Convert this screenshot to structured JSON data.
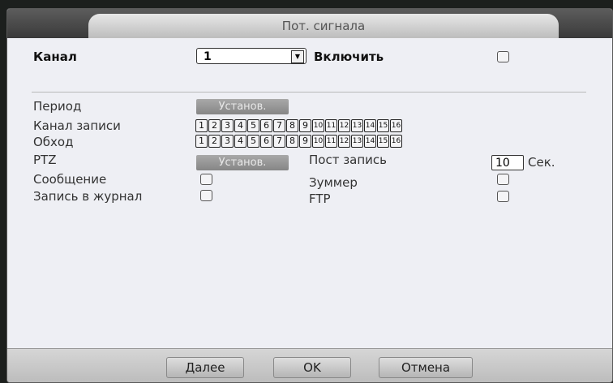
{
  "title": "Пот. сигнала",
  "channel": {
    "label": "Канал",
    "value": "1",
    "enable_label": "Включить"
  },
  "period": {
    "label": "Период",
    "button": "Установ."
  },
  "record_channel": {
    "label": "Канал записи",
    "numbers": [
      "1",
      "2",
      "3",
      "4",
      "5",
      "6",
      "7",
      "8",
      "9",
      "10",
      "11",
      "12",
      "13",
      "14",
      "15",
      "16"
    ]
  },
  "tour": {
    "label": "Обход",
    "numbers": [
      "1",
      "2",
      "3",
      "4",
      "5",
      "6",
      "7",
      "8",
      "9",
      "10",
      "11",
      "12",
      "13",
      "14",
      "15",
      "16"
    ]
  },
  "ptz": {
    "label": "PTZ",
    "button": "Установ."
  },
  "post_record": {
    "label": "Пост запись",
    "value": "10",
    "unit": "Сек."
  },
  "message": {
    "label": "Сообщение"
  },
  "buzzer": {
    "label": "Зуммер"
  },
  "log": {
    "label": "Запись в журнал"
  },
  "ftp": {
    "label": "FTP"
  },
  "buttons": {
    "next": "Далее",
    "ok": "OK",
    "cancel": "Отмена"
  }
}
